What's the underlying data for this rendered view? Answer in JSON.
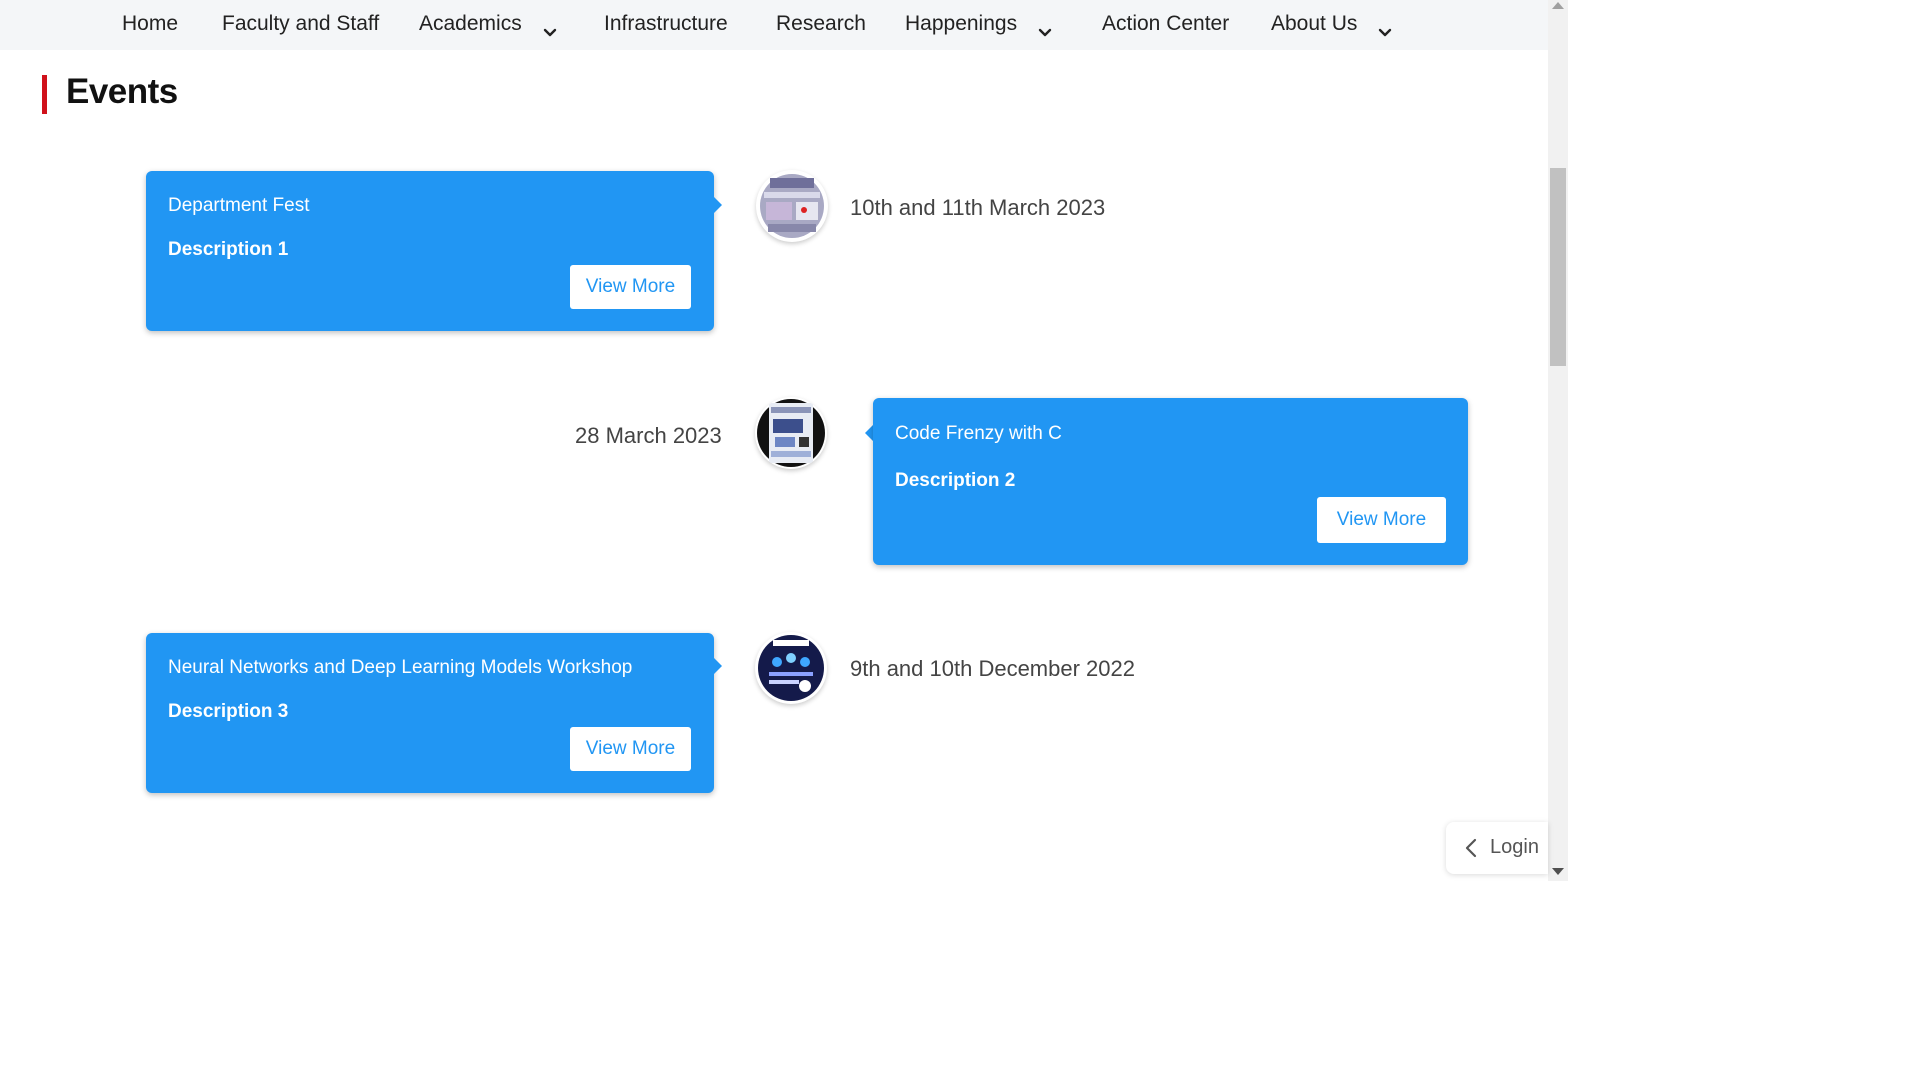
{
  "nav": {
    "items": [
      {
        "label": "Home"
      },
      {
        "label": "Faculty and Staff"
      },
      {
        "label": "Academics"
      },
      {
        "label": "Infrastructure"
      },
      {
        "label": "Research"
      },
      {
        "label": "Happenings"
      },
      {
        "label": "Action Center"
      },
      {
        "label": "About Us"
      }
    ]
  },
  "section": {
    "title": "Events"
  },
  "events": [
    {
      "title": "Department Fest",
      "description": "Description 1",
      "button": "View More",
      "date": "10th and 11th March 2023"
    },
    {
      "title": "Code Frenzy with C",
      "description": "Description 2",
      "button": "View More",
      "date": "28 March 2023"
    },
    {
      "title": "Neural Networks and Deep Learning Models Workshop",
      "description": "Description 3",
      "button": "View More",
      "date": "9th and 10th December 2022"
    }
  ],
  "login": {
    "label": "Login"
  },
  "colors": {
    "accent": "#2196f3",
    "section_bar": "#d0111b",
    "nav_bg": "#f4f6f8"
  }
}
